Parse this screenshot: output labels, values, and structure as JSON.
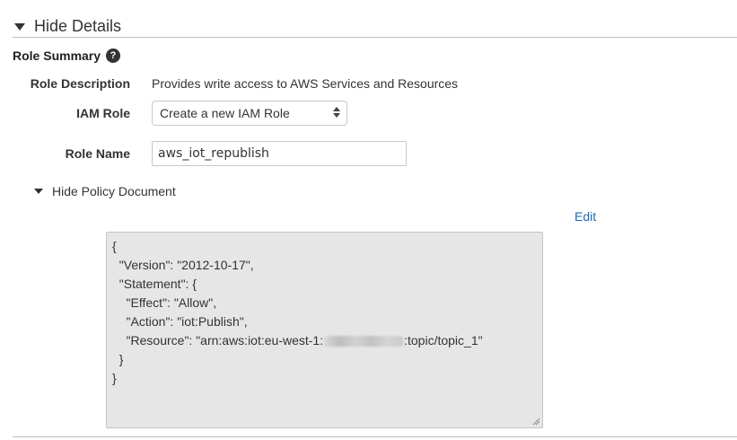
{
  "details_toggle": {
    "label": "Hide Details"
  },
  "role_summary": {
    "title": "Role Summary",
    "help_icon_glyph": "?"
  },
  "fields": {
    "role_description": {
      "label": "Role Description",
      "value": "Provides write access to AWS Services and Resources"
    },
    "iam_role": {
      "label": "IAM Role",
      "selected": "Create a new IAM Role"
    },
    "role_name": {
      "label": "Role Name",
      "value": "aws_iot_republish"
    }
  },
  "policy": {
    "toggle_label": "Hide Policy Document",
    "edit_label": "Edit",
    "lines": {
      "l1": "{",
      "l2": "  \"Version\": \"2012-10-17\",",
      "l3": "  \"Statement\": {",
      "l4": "    \"Effect\": \"Allow\",",
      "l5": "    \"Action\": \"iot:Publish\",",
      "l6_prefix": "    \"Resource\": \"arn:aws:iot:eu-west-1:",
      "l6_suffix": ":topic/topic_1\"",
      "l7": "  }",
      "l8": "}"
    }
  },
  "colors": {
    "link": "#1a6ab5",
    "policy_bg": "#e6e6e6",
    "divider": "#bdbdbd"
  },
  "icons": {
    "toggle": "caret-down-icon",
    "help": "question-circle-icon",
    "select": "select-arrows-icon",
    "resize": "resize-handle-icon"
  }
}
